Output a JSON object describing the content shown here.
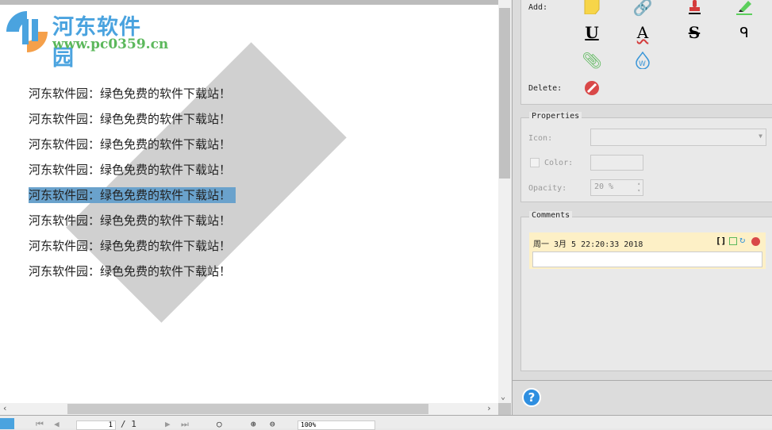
{
  "document": {
    "logo": {
      "title": "河东软件园",
      "url": "www.pc0359.cn"
    },
    "lines": [
      "河东软件园：绿色免费的软件下载站！",
      "河东软件园：绿色免费的软件下载站！",
      "河东软件园：绿色免费的软件下载站！",
      "河东软件园：绿色免费的软件下载站！",
      "河东软件园：绿色免费的软件下载站！",
      "河东软件园：绿色免费的软件下载站！",
      "河东软件园：绿色免费的软件下载站！",
      "河东软件园：绿色免费的软件下载站！"
    ],
    "selected_line": 4
  },
  "annotations": {
    "add_label": "Add:",
    "delete_label": "Delete:",
    "tools": [
      "sticky-note",
      "link",
      "stamp",
      "highlight",
      "underline",
      "squiggly",
      "strikeout",
      "freehand",
      "attachment",
      "watermark"
    ]
  },
  "properties": {
    "title": "Properties",
    "icon_label": "Icon:",
    "icon_value": "",
    "color_label": "Color:",
    "opacity_label": "Opacity:",
    "opacity_value": "20 %"
  },
  "comments": {
    "title": "Comments",
    "items": [
      {
        "date": "周一 3月 5 22:20:33 2018",
        "text": ""
      }
    ]
  },
  "toolbar": {
    "page_value": "1",
    "page_total": "/ 1",
    "zoom_value": "100%"
  }
}
